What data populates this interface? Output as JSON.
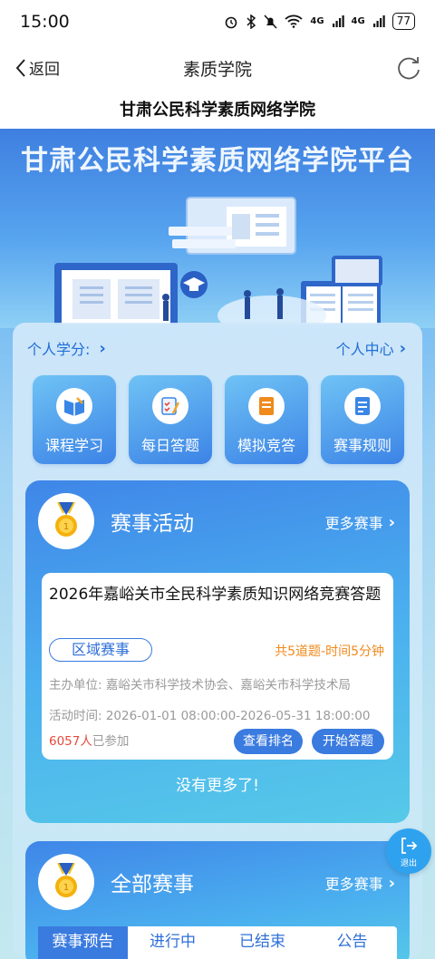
{
  "status": {
    "time": "15:00",
    "battery": "77",
    "net1": "4G",
    "net2": "4G"
  },
  "nav": {
    "back_label": "返回",
    "title": "素质学院"
  },
  "site_title": "甘肃公民科学素质网络学院",
  "banner": {
    "title": "甘肃公民科学素质网络学院平台"
  },
  "panel": {
    "credit_label": "个人学分:",
    "center_label": "个人中心",
    "features": [
      {
        "label": "课程学习",
        "icon": "book-icon"
      },
      {
        "label": "每日答题",
        "icon": "checklist-icon"
      },
      {
        "label": "模拟竞答",
        "icon": "notebook-icon"
      },
      {
        "label": "赛事规则",
        "icon": "rules-doc-icon"
      }
    ]
  },
  "competition": {
    "title": "赛事活动",
    "more_label": "更多赛事",
    "event": {
      "title": "2026年嘉峪关市全民科学素质知识网络竞赛答题",
      "tag": "区域赛事",
      "meta": "共5道题-时间5分钟",
      "organizer": "主办单位: 嘉峪关市科学技术协会、嘉峪关市科学技术局",
      "time": "活动时间: 2026-01-01 08:00:00-2026-05-31 18:00:00",
      "joined_count": "6057人",
      "joined_suffix": "已参加",
      "rank_label": "查看排名",
      "start_label": "开始答题"
    },
    "no_more": "没有更多了!"
  },
  "exit": {
    "label": "退出"
  },
  "all_competitions": {
    "title": "全部赛事",
    "more_label": "更多赛事",
    "tabs": [
      {
        "label": "赛事预告",
        "active": true
      },
      {
        "label": "进行中",
        "active": false
      },
      {
        "label": "已结束",
        "active": false
      },
      {
        "label": "公告",
        "active": false
      }
    ]
  },
  "colors": {
    "primary": "#3a7be0",
    "accent": "#f08a1c",
    "count": "#e84a3c"
  }
}
